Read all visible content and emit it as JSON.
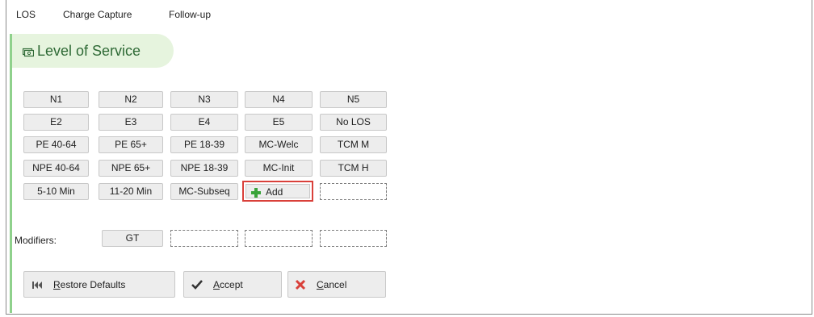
{
  "menu": {
    "items": [
      "LOS",
      "Charge Capture",
      "Follow-up"
    ]
  },
  "panel": {
    "title": "Level of Service",
    "title_icon": "money-icon",
    "accent_color": "#8fd18c"
  },
  "los_grid": {
    "rows": [
      [
        "N1",
        "N2",
        "N3",
        "N4",
        "N5"
      ],
      [
        "E2",
        "E3",
        "E4",
        "E5",
        "No LOS"
      ],
      [
        "PE 40-64",
        "PE 65+",
        "PE 18-39",
        "MC-Welc",
        "TCM M"
      ],
      [
        "NPE 40-64",
        "NPE 65+",
        "NPE 18-39",
        "MC-Init",
        "TCM H"
      ],
      [
        "5-10 Min",
        "11-20 Min",
        "MC-Subseq"
      ]
    ],
    "add_label": "Add",
    "add_icon": "plus-icon",
    "add_highlight_color": "#d9403a"
  },
  "modifiers": {
    "label": "Modifiers:",
    "first_value": "GT"
  },
  "actions": {
    "restore_label": "Restore Defaults",
    "restore_icon": "first-page-icon",
    "accept_label": "Accept",
    "accept_icon": "check-icon",
    "cancel_label": "Cancel",
    "cancel_icon": "x-icon",
    "cancel_icon_color": "#d9403a"
  }
}
